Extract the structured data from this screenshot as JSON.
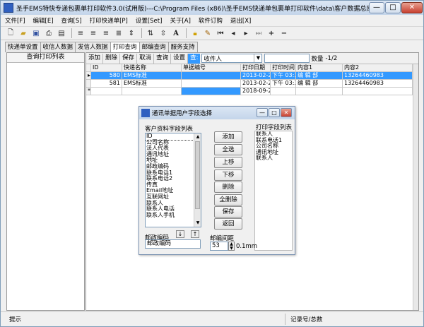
{
  "window": {
    "title": "圣手EMS特快专递包裹单打印软件3.0(试用版)---C:\\Program Files (x86)\\圣手EMS快递单包裹单打印软件\\data\\客户数据总库.mdb",
    "min_glyph": "—",
    "max_glyph": "□",
    "close_glyph": "✕"
  },
  "menu": [
    "文件[F]",
    "编辑[E]",
    "查询[S]",
    "打印快递单[P]",
    "设置[Set]",
    "关于[A]",
    "软件订购",
    "退出[X]"
  ],
  "tabs": [
    "快递单设置",
    "收信人数据",
    "发信人数据",
    "打印查询",
    "邮编查询",
    "服务支持"
  ],
  "left_panel": {
    "header": "查询打印列表"
  },
  "query_bar": {
    "buttons": [
      "添加",
      "删除",
      "保存",
      "取消",
      "查询",
      "设置"
    ],
    "field_label": "查:",
    "field_value": "收件人",
    "count_label": "数量",
    "count_value": "-1/2"
  },
  "grid": {
    "columns": [
      "ID",
      "快递名称",
      "单据编号",
      "打印日期",
      "打印时间",
      "内容1",
      "内容2"
    ],
    "rows": [
      {
        "ind": "▸",
        "id": "580",
        "name": "EMS标准",
        "no": "",
        "date": "2013-02-25",
        "time": "下午 03:3",
        "c1": "编 辑 部",
        "c2": "13264460983"
      },
      {
        "ind": "",
        "id": "581",
        "name": "EMS标准",
        "no": "",
        "date": "2013-02-25",
        "time": "下午 03:3",
        "c1": "编 辑 部",
        "c2": "13264460983"
      },
      {
        "ind": "*",
        "id": "",
        "name": "",
        "no": "",
        "date": "2018-09-20",
        "time": "",
        "c1": "",
        "c2": ""
      }
    ]
  },
  "dialog": {
    "title": "通讯单据用户字段选择",
    "left_label": "客户资料字段列表",
    "right_label": "打印字段列表",
    "left_items": [
      "ID",
      "公司名称",
      "法人代表",
      "通讯地址",
      "地址",
      "邮政编码",
      "联系电话1",
      "联系电话2",
      "传真",
      "Email地址",
      "互联网址",
      "联系人",
      "联系人电话",
      "联系人手机"
    ],
    "right_items": [
      "联系人",
      "联系电话1",
      "公司名称",
      "通讯地址",
      "联系人"
    ],
    "buttons": [
      "添加",
      "全选",
      "上移",
      "下移",
      "删除",
      "全删除",
      "保存",
      "返回"
    ],
    "field1_label": "邮政编码",
    "field1_value": "邮政编码",
    "spacing_label": "邮编间距",
    "spacing_value": "53",
    "spacing_unit": "0.1mm",
    "arrow_down": "↓",
    "arrow_up": "↑"
  },
  "status": {
    "left": "提示",
    "right": "记录号/总数"
  }
}
